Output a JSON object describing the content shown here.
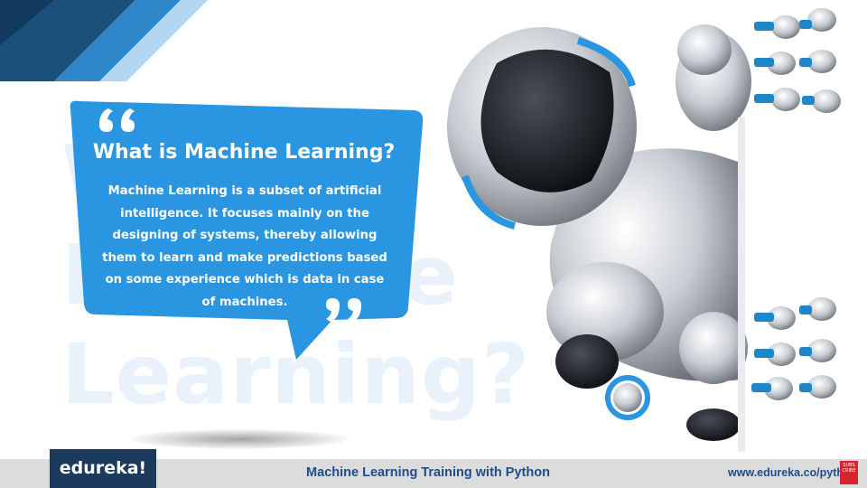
{
  "slide": {
    "watermark_text": "What is\nMachine\nLearning?",
    "bubble_title": "What is Machine Learning?",
    "bubble_body": "Machine Learning is a subset of artificial intelligence. It focuses mainly on the designing of systems,  thereby allowing them to learn and make predictions based on some experience which is data in case of machines."
  },
  "footer": {
    "logo": "edureka!",
    "course_title": "Machine Learning Training with Python",
    "website": "www.edureka.co/python",
    "subscribe_badge": "SUBS CRIBE"
  },
  "colors": {
    "bubble_blue": "#2a95e0",
    "logo_bg": "#1b3a5c",
    "footer_bg": "#dcdcdc",
    "title_blue": "#1f4d8a"
  }
}
